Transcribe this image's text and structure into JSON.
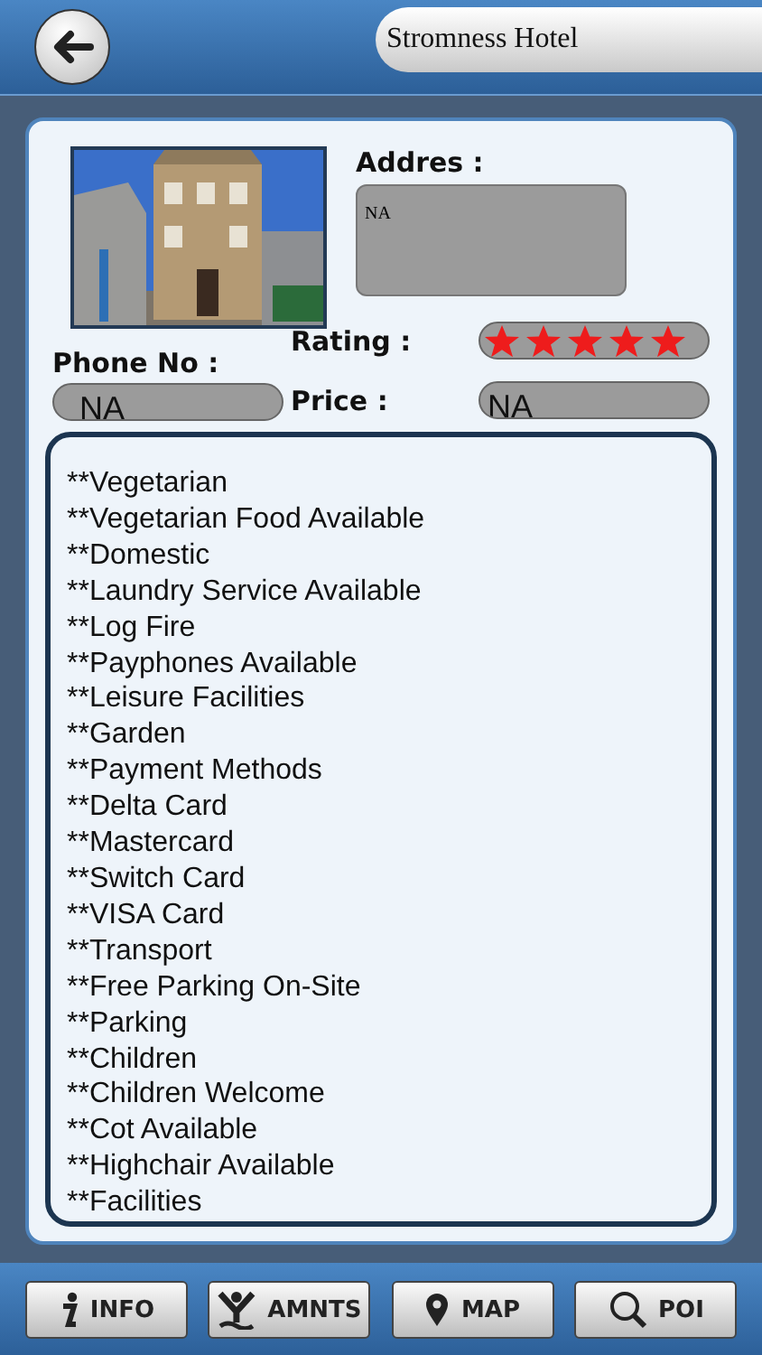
{
  "header": {
    "title": "Stromness Hotel"
  },
  "details": {
    "address_label": "Addres :",
    "address": "NA",
    "rating_label": "Rating :",
    "stars": 5,
    "phone_label": "Phone No :",
    "phone": "NA",
    "price_label": "Price :",
    "price": "NA"
  },
  "amenities": [
    "**Vegetarian",
    "**Vegetarian Food Available",
    "**Domestic",
    "**Laundry Service Available",
    "**Log Fire",
    "**Payphones Available",
    "**Leisure Facilities",
    "**Garden",
    "**Payment Methods",
    "**Delta Card",
    "**Mastercard",
    "**Switch Card",
    "**VISA Card",
    "**Transport",
    "**Free Parking On-Site",
    "**Parking",
    "**Children",
    "**Children Welcome",
    "**Cot Available",
    "**Highchair Available",
    "**Facilities"
  ],
  "tabs": [
    {
      "kind": "info",
      "label": "INFO"
    },
    {
      "kind": "amenities",
      "label": "AMNTS"
    },
    {
      "kind": "map",
      "label": "MAP"
    },
    {
      "kind": "poi",
      "label": "POI"
    }
  ]
}
